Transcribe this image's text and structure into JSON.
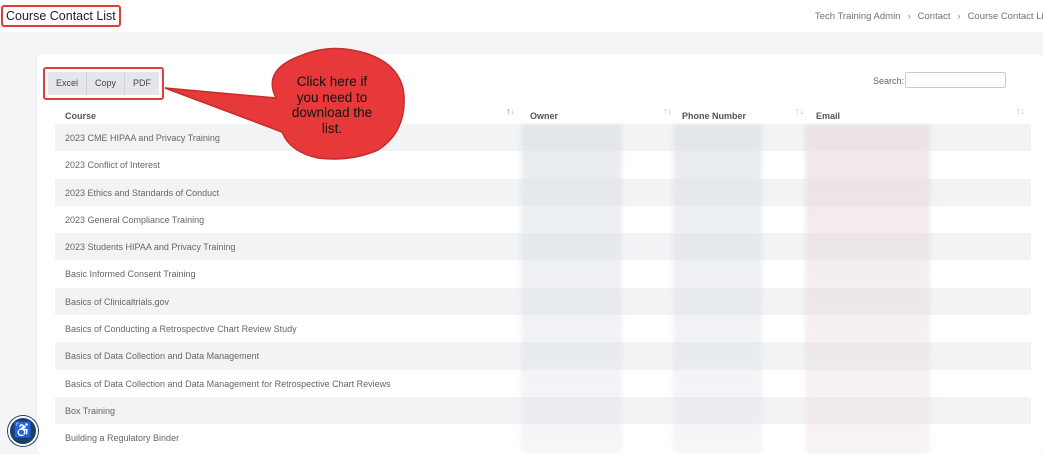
{
  "header": {
    "page_title": "Course Contact List",
    "breadcrumb": [
      "Tech Training Admin",
      "Contact",
      "Course Contact List"
    ],
    "breadcrumb_sep": "›"
  },
  "toolbar": {
    "buttons": [
      "Excel",
      "Copy",
      "PDF"
    ],
    "search_label": "Search:",
    "search_value": ""
  },
  "table": {
    "columns": [
      "Course",
      "Owner",
      "Phone Number",
      "Email"
    ],
    "sort_up": "↑",
    "sort_down": "↓",
    "rows": [
      "2023 CME HIPAA and Privacy Training",
      "2023 Conflict of Interest",
      "2023 Ethics and Standards of Conduct",
      "2023 General Compliance Training",
      "2023 Students HIPAA and Privacy Training",
      "Basic Informed Consent Training",
      "Basics of Clinicaltrials.gov",
      "Basics of Conducting a Retrospective Chart Review Study",
      "Basics of Data Collection and Data Management",
      "Basics of Data Collection and Data Management for Retrospective Chart Reviews",
      "Box Training",
      "Building a Regulatory Binder"
    ]
  },
  "callout": {
    "lines": [
      "Click here if",
      "you need to",
      "download the",
      "list."
    ],
    "color": "#e8393a"
  },
  "accessibility": {
    "icon": "accessibility-icon",
    "glyph": "♿"
  }
}
